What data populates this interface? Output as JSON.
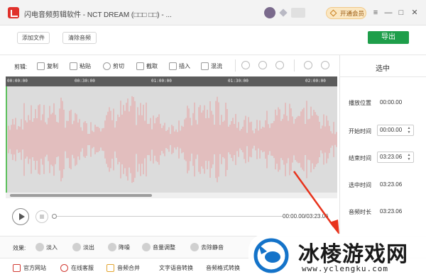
{
  "window": {
    "title": "闪电音频剪辑软件 - NCT DREAM (□□□ □□) - ...",
    "vip_label": "开通会员",
    "controls": [
      "≡",
      "—",
      "□",
      "✕"
    ]
  },
  "top_actions": {
    "add_file": "添加文件",
    "clear_audio": "清除音频",
    "export": "导出"
  },
  "toolbar": {
    "label": "剪辑:",
    "items": [
      "复制",
      "粘贴",
      "剪切",
      "截取",
      "插入",
      "混流"
    ]
  },
  "ruler": {
    "ticks": [
      "00:00:00",
      "00:30:00",
      "01:00:00",
      "01:30:00",
      "02:00:00"
    ]
  },
  "waveform": {
    "color": "#e8a1a1",
    "background": "#dcdcdc"
  },
  "playback": {
    "time": "00:00.00/03:23.06"
  },
  "selection_panel": {
    "title": "选中",
    "play_position_label": "播放位置",
    "play_position": "00:00.00",
    "start_label": "开始时间",
    "start": "00:00.00",
    "end_label": "结束时间",
    "end": "03:23.06",
    "selected_label": "选中时间",
    "selected": "03:23.06",
    "duration_label": "音频时长",
    "duration": "03:23.06"
  },
  "effects": {
    "label": "效果:",
    "items": [
      "淡入",
      "淡出",
      "降噪",
      "音量调整",
      "去除静音"
    ]
  },
  "bottom_bar": {
    "items": [
      "官方网站",
      "在线客服",
      "音频合并",
      "文字语音转换",
      "音频格式转换"
    ]
  },
  "watermark": {
    "brand": "冰棱游戏网",
    "url": "www.yclengku.com",
    "arrow_color": "#e8331c",
    "logo_color": "#1473c9"
  }
}
